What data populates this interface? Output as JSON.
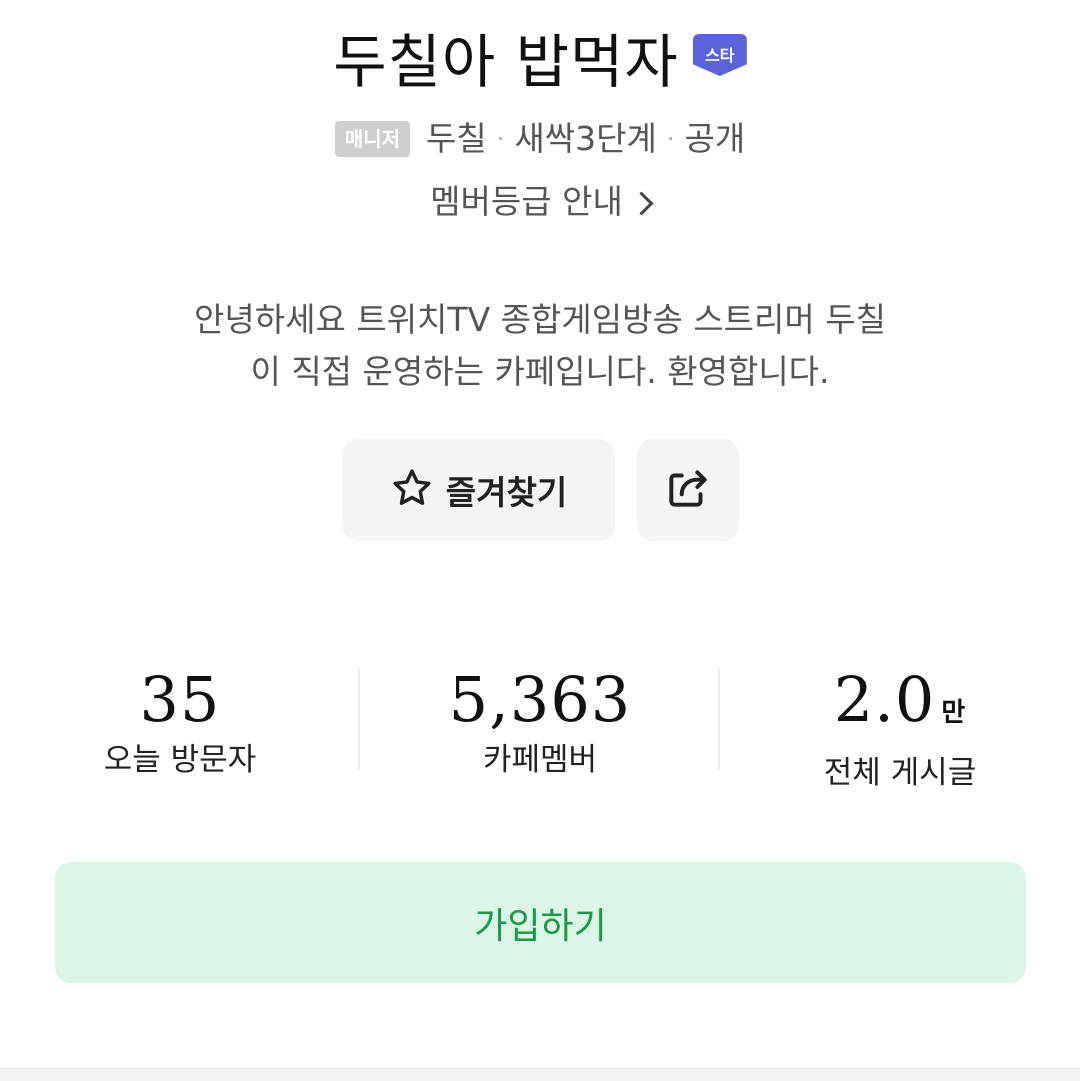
{
  "cafe": {
    "title": "두칠아 밥먹자",
    "star_badge": "스타",
    "manager_badge": "매니저",
    "manager_name": "두칠",
    "level": "새싹3단계",
    "visibility": "공개",
    "separator": "·",
    "grade_guide": "멤버등급 안내",
    "description_line1": "안녕하세요 트위치TV 종합게임방송 스트리머 두칠",
    "description_line2": "이 직접 운영하는 카페입니다. 환영합니다."
  },
  "actions": {
    "favorite_label": "즐겨찾기",
    "favorite_icon": "star-outline-icon",
    "share_icon": "share-icon",
    "join_label": "가입하기"
  },
  "stats": {
    "visitors_value": "35",
    "visitors_label": "오늘 방문자",
    "members_value": "5,363",
    "members_label": "카페멤버",
    "posts_value": "2.0",
    "posts_unit": "만",
    "posts_label": "전체 게시글"
  },
  "colors": {
    "star_badge": "#5b63d9",
    "join_bg": "#dbf5e6",
    "join_text": "#1a9a46",
    "button_bg": "#f3f4f6"
  }
}
